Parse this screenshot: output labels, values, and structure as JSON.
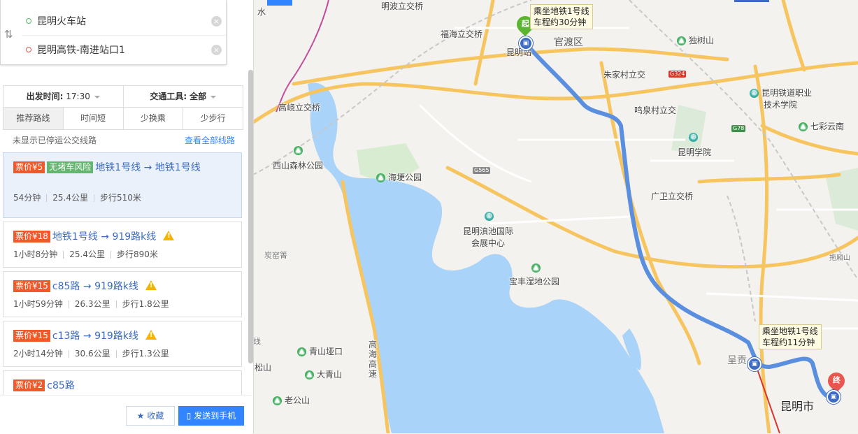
{
  "search": {
    "start": "昆明火车站",
    "end": "昆明高铁-南进站口1",
    "clear_icon": "close-circle-icon",
    "swap_icon": "swap-arrows-icon"
  },
  "options": {
    "depart_label": "出发时间:",
    "depart_value": "17:30",
    "transport_label": "交通工具:",
    "transport_value": "全部",
    "tabs": [
      "推荐路线",
      "时间短",
      "少换乘",
      "少步行"
    ],
    "active_tab": 0
  },
  "notice": "未显示已停运公交线路",
  "view_all": "查看全部线路",
  "routes": [
    {
      "price_label": "票价",
      "price": "¥5",
      "tag": "无堵车风险",
      "lines": "地铁1号线 → 地铁1号线",
      "duration": "54分钟",
      "distance": "25.4公里",
      "walk": "步行510米",
      "warning": false,
      "selected": true
    },
    {
      "price_label": "票价",
      "price": "¥18",
      "tag": "",
      "lines": "地铁1号线 → 919路k线",
      "duration": "1小时8分钟",
      "distance": "25.4公里",
      "walk": "步行890米",
      "warning": true,
      "selected": false
    },
    {
      "price_label": "票价",
      "price": "¥15",
      "tag": "",
      "lines": "c85路 → 919路k线",
      "duration": "1小时59分钟",
      "distance": "26.3公里",
      "walk": "步行1.8公里",
      "warning": true,
      "selected": false
    },
    {
      "price_label": "票价",
      "price": "¥15",
      "tag": "",
      "lines": "c13路 → 919路k线",
      "duration": "2小时14分钟",
      "distance": "30.6公里",
      "walk": "步行1.3公里",
      "warning": true,
      "selected": false
    },
    {
      "price_label": "票价",
      "price": "¥2",
      "tag": "",
      "lines": "c85路",
      "duration": "",
      "distance": "",
      "walk": "",
      "warning": false,
      "selected": false
    }
  ],
  "footer": {
    "favorite": "收藏",
    "send_phone": "发送到手机"
  },
  "map": {
    "labels": {
      "mingbo": "明波立交桥",
      "fuhai": "福海立交桥",
      "kunming_station": "昆明站",
      "guandu": "官渡区",
      "dushushan": "独树山",
      "zhujiacun": "朱家村立交",
      "gaoyao": "高峣立交桥",
      "mingquan": "鸣泉村立交",
      "tiedao_line1": "昆明铁道职业",
      "tiedao_line2": "技术学院",
      "qicai": "七彩云南",
      "xishan": "西山森林公园",
      "haigeng": "海埂公园",
      "kmxy": "昆明学院",
      "guangwei": "广卫立交桥",
      "dianchi_line1": "昆明滇池国际",
      "dianchi_line2": "会展中心",
      "tanyao": "炭窑箐",
      "baofeng": "宝丰湿地公园",
      "qingshan": "青山垭口",
      "dadaqing": "大青山",
      "laogong": "老公山",
      "chenggong": "呈贡",
      "kunming_city": "昆明市",
      "gaohai": "高海高速",
      "songshan": "松山",
      "tuodong": "拖厢山",
      "shui": "水",
      "xian": "线"
    },
    "bubble_start": {
      "line1": "乘坐地铁1号线",
      "line2": "车程约30分钟"
    },
    "bubble_end": {
      "line1": "乘坐地铁1号线",
      "line2": "车程约11分钟"
    },
    "marker_start": "起",
    "marker_end": "终",
    "shields": {
      "g324": "G324",
      "g565": "G565",
      "g78": "G78"
    },
    "colors": {
      "route": "#5a8fdf",
      "water": "#a9d3f8",
      "expressway": "#f6c560",
      "park": "#cfe7c8"
    }
  }
}
